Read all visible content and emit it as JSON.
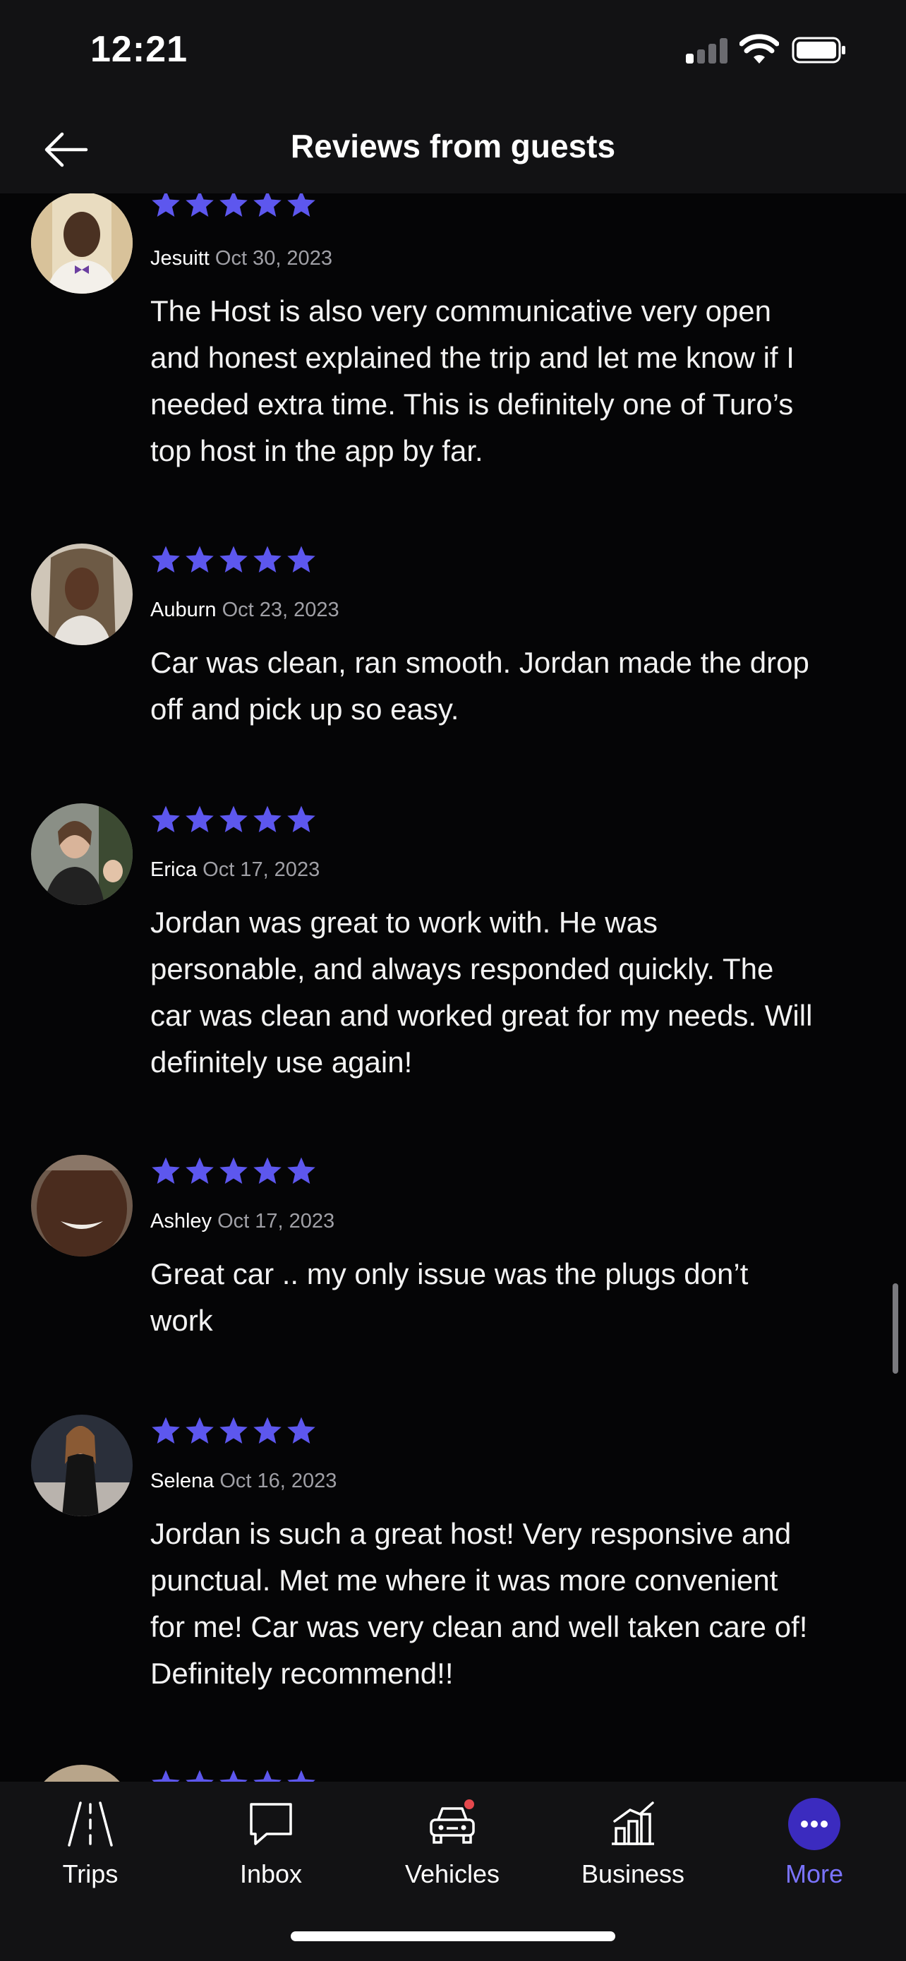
{
  "status_bar": {
    "time": "12:21"
  },
  "header": {
    "title": "Reviews from guests"
  },
  "colors": {
    "star": "#5d57ee",
    "accent": "#7a73ff",
    "background": "#050506",
    "bar": "#121214"
  },
  "reviews": [
    {
      "name": "Jesuitt",
      "date": "Oct 30, 2023",
      "rating": 5,
      "text_lines": [
        "The Host is also very communicative very open",
        "and honest explained the trip and let me know if I",
        "needed extra time. This is definitely one of Turo’s",
        "top host in the app by far."
      ]
    },
    {
      "name": "Auburn",
      "date": "Oct 23, 2023",
      "rating": 5,
      "text_lines": [
        "Car was clean, ran smooth. Jordan made the drop",
        "off and pick up so easy."
      ]
    },
    {
      "name": "Erica",
      "date": "Oct 17, 2023",
      "rating": 5,
      "text_lines": [
        "Jordan was great to work with. He was",
        "personable, and always responded quickly. The",
        "car was clean and worked great for my needs. Will",
        "definitely use again!"
      ]
    },
    {
      "name": "Ashley",
      "date": "Oct 17, 2023",
      "rating": 5,
      "text_lines": [
        "Great car .. my only issue was the plugs don’t",
        "work"
      ]
    },
    {
      "name": "Selena",
      "date": "Oct 16, 2023",
      "rating": 5,
      "text_lines": [
        "Jordan is such a great host! Very responsive and",
        "punctual. Met me where it was more convenient",
        "for me! Car was very clean and well taken care of!",
        "Definitely recommend!!"
      ]
    }
  ],
  "tabs": [
    {
      "label": "Trips",
      "icon": "trips-road-icon"
    },
    {
      "label": "Inbox",
      "icon": "chat-bubble-icon"
    },
    {
      "label": "Vehicles",
      "icon": "car-icon"
    },
    {
      "label": "Business",
      "icon": "bar-chart-icon"
    },
    {
      "label": "More",
      "icon": "more-dots-icon",
      "active": true
    }
  ]
}
